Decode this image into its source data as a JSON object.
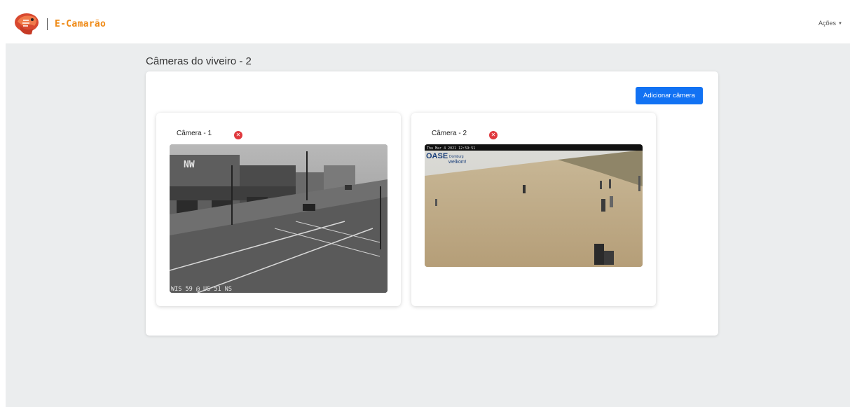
{
  "nav": {
    "brand": "E-Camarão",
    "actions_label": "Ações",
    "logo_icon": "shrimp-logo-icon"
  },
  "page": {
    "title": "Câmeras do viveiro - 2"
  },
  "panel": {
    "add_button_label": "Adicionar câmera"
  },
  "cameras": [
    {
      "title": "Câmera - 1",
      "remove_icon": "close-circle-icon",
      "feed_overlay": "WIS 59 @ US 51 NS",
      "sign_text": "NW"
    },
    {
      "title": "Câmera - 2",
      "remove_icon": "close-circle-icon",
      "feed_timestamp": "Thu Mar  4 2021  12:59:51",
      "feed_brand": "OASE",
      "feed_brand_small": "Domburg",
      "feed_tagline": "welkom!"
    }
  ],
  "colors": {
    "brand": "#ef8a16",
    "primary": "#1272f3",
    "danger": "#e0393e",
    "background": "#ebedee"
  }
}
